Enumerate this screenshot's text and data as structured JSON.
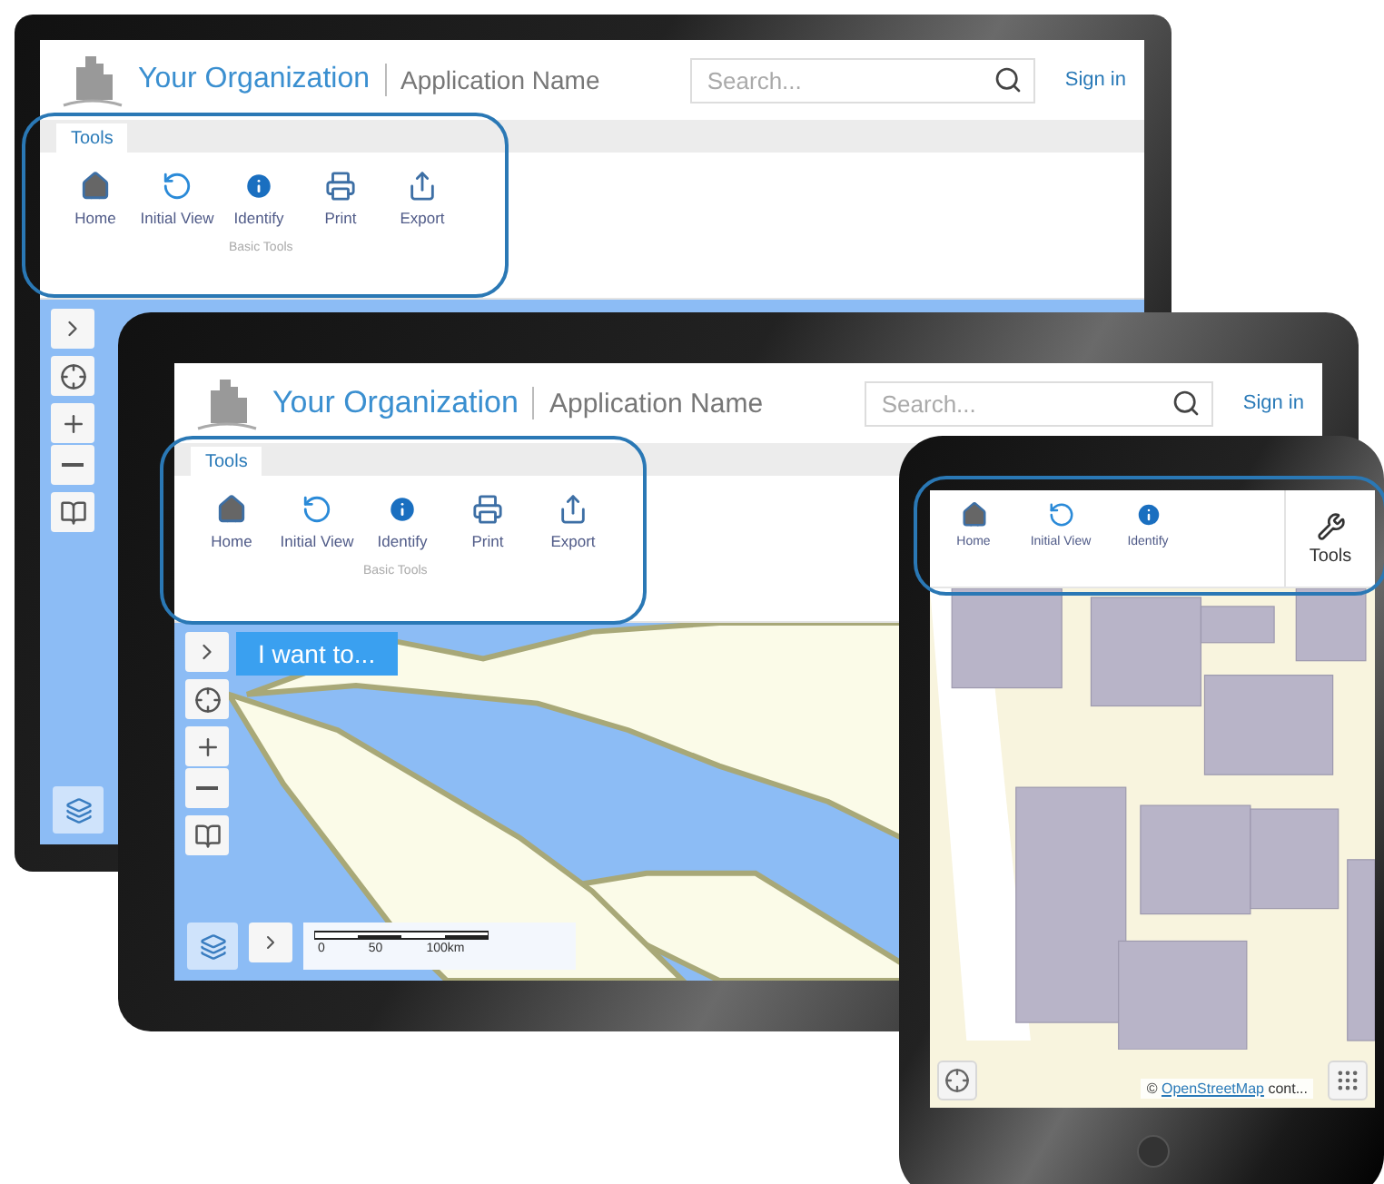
{
  "devices": [
    {
      "kind": "monitor",
      "header": {
        "organization": "Your Organization",
        "application": "Application Name",
        "search_placeholder": "Search...",
        "sign_in": "Sign in"
      },
      "tabs": [
        {
          "label": "Tools",
          "selected": true
        }
      ],
      "tools": [
        {
          "label": "Home"
        },
        {
          "label": "Initial View"
        },
        {
          "label": "Identify"
        },
        {
          "label": "Print"
        },
        {
          "label": "Export"
        }
      ],
      "group_label": "Basic Tools"
    },
    {
      "kind": "tablet",
      "header": {
        "organization": "Your Organization",
        "application": "Application Name",
        "search_placeholder": "Search...",
        "sign_in": "Sign in"
      },
      "tabs": [
        {
          "label": "Tools",
          "selected": true
        }
      ],
      "tools": [
        {
          "label": "Home"
        },
        {
          "label": "Initial View"
        },
        {
          "label": "Identify"
        },
        {
          "label": "Print"
        },
        {
          "label": "Export"
        }
      ],
      "group_label": "Basic Tools",
      "menu_button": "I want to...",
      "scale_labels": [
        "0",
        "50",
        "100km"
      ]
    },
    {
      "kind": "phone",
      "tools": [
        {
          "label": "Home"
        },
        {
          "label": "Initial View"
        },
        {
          "label": "Identify"
        }
      ],
      "tools_button": "Tools",
      "attribution": {
        "prefix": "©",
        "link": "OpenStreetMap",
        "suffix": "cont..."
      }
    }
  ]
}
